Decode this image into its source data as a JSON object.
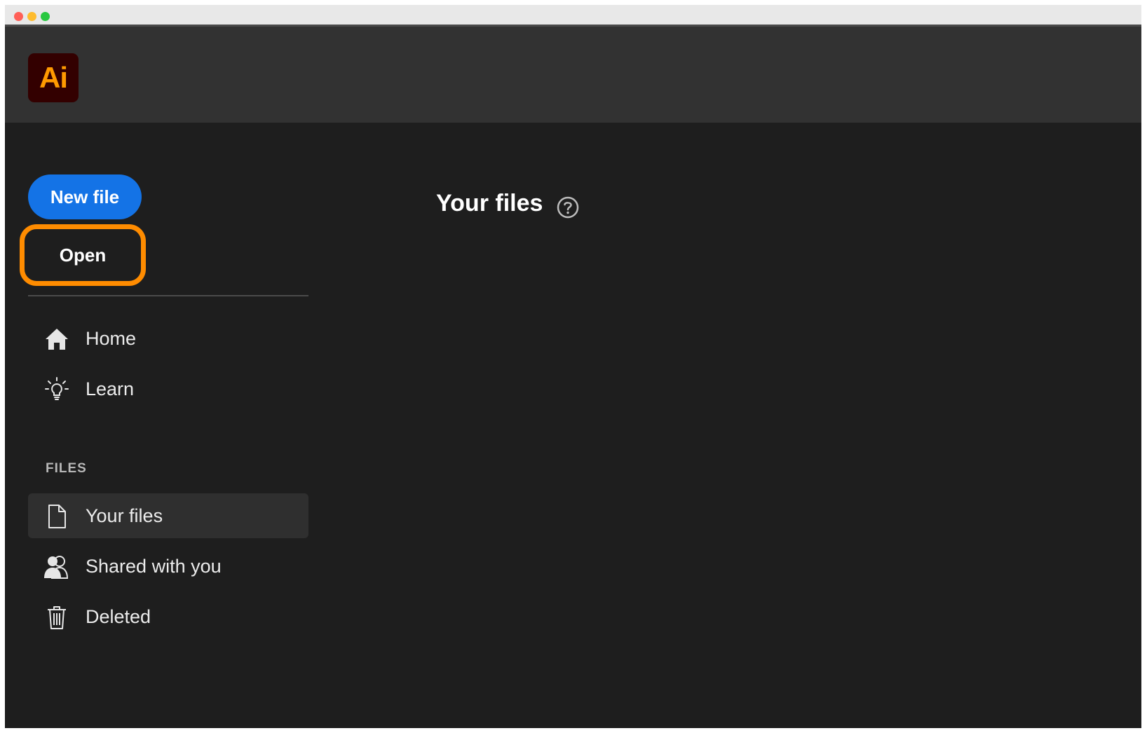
{
  "window": {
    "traffic_lights": {
      "close_color": "#ff5f57",
      "minimize_color": "#febc2e",
      "zoom_color": "#28c840"
    }
  },
  "header": {
    "app_logo_text": "Ai",
    "app_logo_icon": "adobe-illustrator-logo"
  },
  "sidebar": {
    "new_file_label": "New file",
    "open_label": "Open",
    "nav_items": [
      {
        "label": "Home",
        "icon": "home-icon"
      },
      {
        "label": "Learn",
        "icon": "lightbulb-icon"
      }
    ],
    "files_heading": "FILES",
    "file_items": [
      {
        "label": "Your files",
        "icon": "document-icon",
        "selected": true
      },
      {
        "label": "Shared with you",
        "icon": "people-icon",
        "selected": false
      },
      {
        "label": "Deleted",
        "icon": "trash-icon",
        "selected": false
      }
    ]
  },
  "main": {
    "title": "Your files",
    "help_icon": "help-icon"
  },
  "colors": {
    "accent_blue": "#1473e6",
    "highlight_orange": "#ff8c00",
    "logo_orange": "#ff9a00",
    "logo_bg": "#330000",
    "background": "#1e1e1e",
    "header_bg": "#323232"
  }
}
